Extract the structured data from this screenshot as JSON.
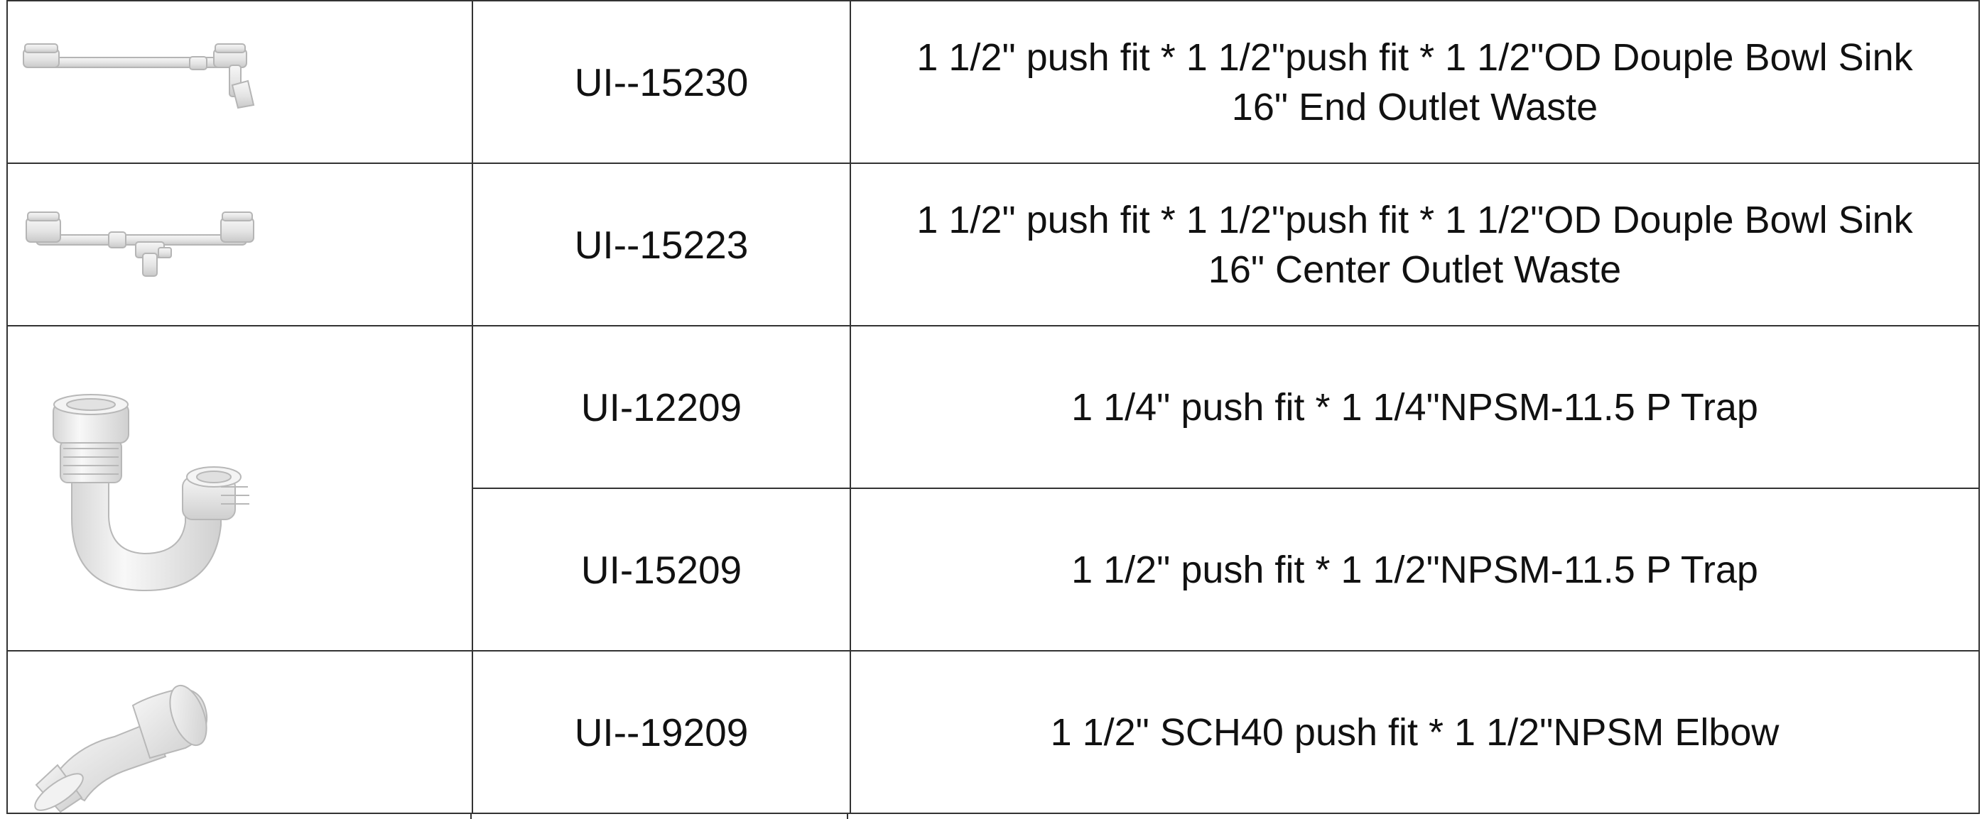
{
  "rows": [
    {
      "code": "UI--15230",
      "desc_line1": "1 1/2\"  push fit * 1 1/2\"push fit * 1 1/2\"OD Douple Bowl Sink",
      "desc_line2": "16\" End Outlet Waste",
      "image": "double-bowl-sink-end-outlet-waste"
    },
    {
      "code": "UI--15223",
      "desc_line1": "1 1/2\"  push fit * 1 1/2\"push fit * 1 1/2\"OD Douple Bowl Sink",
      "desc_line2": "16\" Center Outlet Waste",
      "image": "double-bowl-sink-center-outlet-waste"
    },
    {
      "code": "UI-12209",
      "desc_line1": "1 1/4\"  push fit * 1 1/4\"NPSM-11.5  P Trap",
      "image": "p-trap"
    },
    {
      "code": "UI-15209",
      "desc_line1": "1 1/2\"  push fit * 1 1/2\"NPSM-11.5  P Trap"
    },
    {
      "code": "UI--19209",
      "desc_line1": "1 1/2\" SCH40 push fit * 1 1/2\"NPSM  Elbow",
      "image": "elbow"
    }
  ],
  "colors": {
    "border": "#333333",
    "text": "#111111",
    "pvc": "#e9e9e9"
  }
}
